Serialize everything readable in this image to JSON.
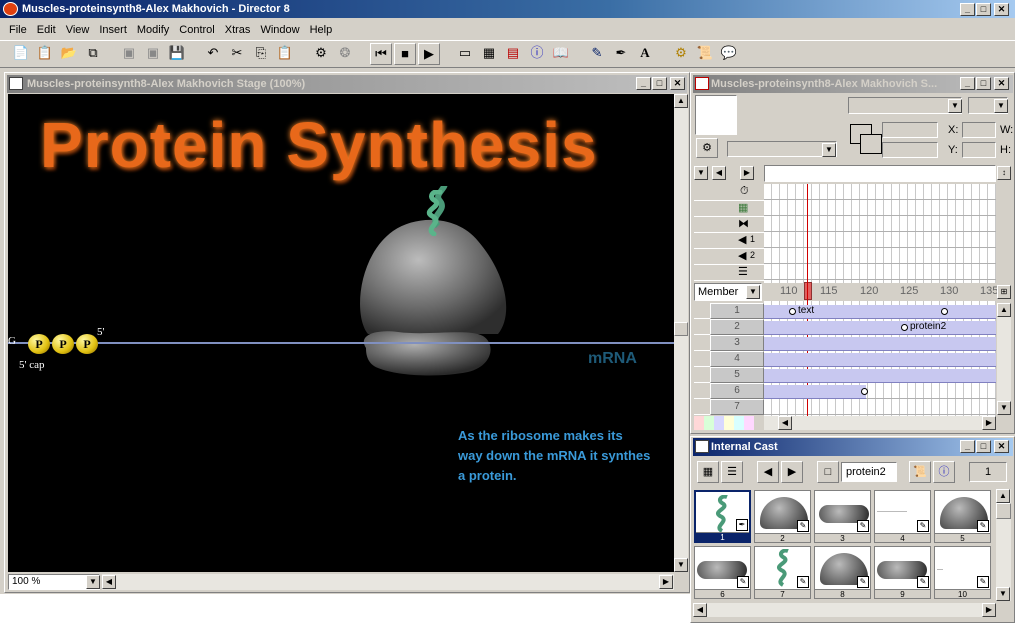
{
  "app": {
    "title": "Muscles-proteinsynth8-Alex Makhovich - Director 8"
  },
  "menu": [
    "File",
    "Edit",
    "View",
    "Insert",
    "Modify",
    "Control",
    "Xtras",
    "Window",
    "Help"
  ],
  "stage": {
    "title": "Muscles-proteinsynth8-Alex Makhovich Stage (100%)",
    "heading": "Protein Synthesis",
    "cap_label": "5' cap",
    "five_prime": "5'",
    "g_label": "G",
    "p_label": "P",
    "mrna_label": "mRNA",
    "caption_lines": [
      "As the ribosome makes its",
      "way down the mRNA it synthes",
      "a protein."
    ],
    "zoom": "100 %"
  },
  "score": {
    "title": "Muscles-proteinsynth8-Alex Makhovich S...",
    "x_label": "X:",
    "y_label": "Y:",
    "w_label": "W:",
    "h_label": "H:",
    "display_mode": "Member",
    "frame_labels": [
      "110",
      "115",
      "120",
      "125",
      "130",
      "135"
    ],
    "channels": [
      "1",
      "2",
      "3",
      "4",
      "5",
      "6",
      "7"
    ],
    "sprite_labels": {
      "ch1": "text",
      "ch2": "protein2"
    },
    "effect_channel_labels": [
      "1",
      "2"
    ]
  },
  "cast": {
    "title": "Internal Cast",
    "member_name": "protein2",
    "member_number": "1",
    "cells": [
      "1",
      "2",
      "3",
      "4",
      "5",
      "6",
      "7",
      "8",
      "9",
      "10"
    ]
  },
  "colors": {
    "accent": "#0a246a",
    "stage_bg": "#000000",
    "heading": "#ff6a1a",
    "caption": "#3a9ad9",
    "mrna": "#1e5a78"
  }
}
